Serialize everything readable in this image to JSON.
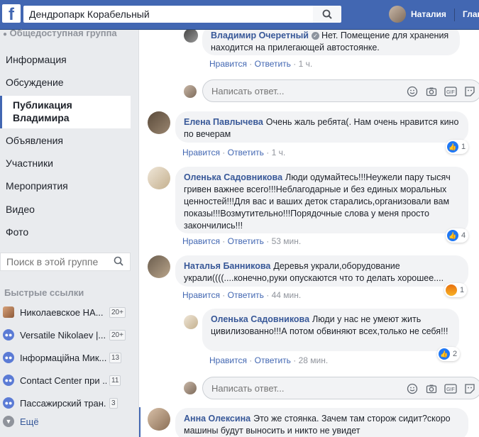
{
  "topbar": {
    "logo": "f",
    "search_value": "Дендропарк Корабельный",
    "user_name": "Наталия",
    "home_label": "Главная"
  },
  "sidebar": {
    "group_type": "Общедоступная группа",
    "items": [
      {
        "label": "Информация"
      },
      {
        "label": "Обсуждение"
      },
      {
        "label": "Публикация Владимира"
      },
      {
        "label": "Объявления"
      },
      {
        "label": "Участники"
      },
      {
        "label": "Мероприятия"
      },
      {
        "label": "Видео"
      },
      {
        "label": "Фото"
      }
    ],
    "search_placeholder": "Поиск в этой группе",
    "quick_links_header": "Быстрые ссылки",
    "quick_links": [
      {
        "label": "Николаевское НА...",
        "badge": "20+",
        "icon": "group-photo-icon"
      },
      {
        "label": "Versatile Nikolaev |...",
        "badge": "20+",
        "icon": "group-icon"
      },
      {
        "label": "Інформаційна Мик...",
        "badge": "13",
        "icon": "group-icon"
      },
      {
        "label": "Contact Center при ...",
        "badge": "11",
        "icon": "group-icon"
      },
      {
        "label": "Пассажирский тран...",
        "badge": "3",
        "icon": "group-icon"
      }
    ],
    "more_label": "Ещё"
  },
  "feed": {
    "comments": [
      {
        "author": "Владимир Очеретный",
        "text": "Нет. Помещение для хранения находится на прилегающей автостоянке.",
        "like": "Нравится",
        "reply": "Ответить",
        "time": "1 ч."
      },
      {
        "author": "Елена Павлычева",
        "text": "Очень жаль ребята(. Нам очень нравится кино по вечерам",
        "like": "Нравится",
        "reply": "Ответить",
        "time": "1 ч.",
        "reaction_count": "1"
      },
      {
        "author": "Оленька Садовникова",
        "text": "Люди одумайтесь!!!Неужели пару тысяч гривен важнее всего!!!Неблагодарные и без единых моральных ценностей!!!Для вас и ваших деток старались,организовали вам показы!!!Возмутительно!!!Порядочные слова у меня просто закончились!!!",
        "like": "Нравится",
        "reply": "Ответить",
        "time": "53 мин.",
        "reaction_count": "4"
      },
      {
        "author": "Наталья Банникова",
        "text": "Деревья украли,оборудование украли((((....конечно,руки опускаются что то делать хорошее....",
        "like": "Нравится",
        "reply": "Ответить",
        "time": "44 мин.",
        "reaction_count": "1"
      },
      {
        "author": "Оленька Садовникова",
        "text": "Люди у нас не умеют жить цивилизованно!!!А потом обвиняют всех,только не себя!!!",
        "like": "Нравится",
        "reply": "Ответить",
        "time": "28 мин.",
        "reaction_count": "2"
      },
      {
        "author": "Анна Олексина",
        "text": "Это же стоянка. Зачем там сторож сидит?скоро машины будут выносить и никто не увидет"
      }
    ],
    "reply_placeholder": "Написать ответ...",
    "separator": "·"
  },
  "colors": {
    "brand": "#4267b2",
    "link": "#385898",
    "like_blue": "#2078f4"
  }
}
